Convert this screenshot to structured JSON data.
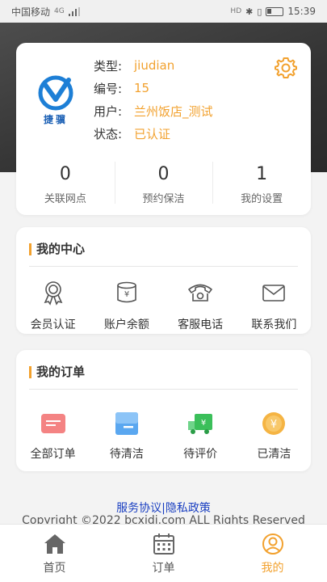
{
  "status_bar": {
    "carrier": "中国移动",
    "signal": "4G",
    "time": "15:39",
    "indicators": "HD"
  },
  "profile": {
    "logo_text": "捷骥",
    "rows": [
      {
        "label": "类型:",
        "value": "jiudian"
      },
      {
        "label": "编号:",
        "value": "15"
      },
      {
        "label": "用户:",
        "value": "兰州饭店_测试"
      },
      {
        "label": "状态:",
        "value": "已认证"
      }
    ],
    "stats": [
      {
        "num": "0",
        "label": "关联网点"
      },
      {
        "num": "0",
        "label": "预约保洁"
      },
      {
        "num": "1",
        "label": "我的设置"
      }
    ]
  },
  "center": {
    "title": "我的中心",
    "items": [
      {
        "label": "会员认证",
        "icon": "badge-icon"
      },
      {
        "label": "账户余额",
        "icon": "wallet-icon"
      },
      {
        "label": "客服电话",
        "icon": "phone-icon"
      },
      {
        "label": "联系我们",
        "icon": "mail-icon"
      }
    ]
  },
  "orders": {
    "title": "我的订单",
    "items": [
      {
        "label": "全部订单",
        "icon": "card-icon"
      },
      {
        "label": "待清洁",
        "icon": "box-icon"
      },
      {
        "label": "待评价",
        "icon": "truck-icon"
      },
      {
        "label": "已清洁",
        "icon": "coin-icon"
      }
    ]
  },
  "footer": {
    "links": "服务协议|隐私政策",
    "copyright": "Copyright ©2022 bcxidi.com ALL Rights Reserved"
  },
  "tabbar": {
    "tabs": [
      {
        "label": "首页",
        "icon": "home-icon"
      },
      {
        "label": "订单",
        "icon": "calendar-icon"
      },
      {
        "label": "我的",
        "icon": "user-icon"
      }
    ],
    "active": 2
  },
  "colors": {
    "accent": "#f2a12e",
    "link": "#1a3fc1",
    "hero": "#3a3a3a"
  }
}
